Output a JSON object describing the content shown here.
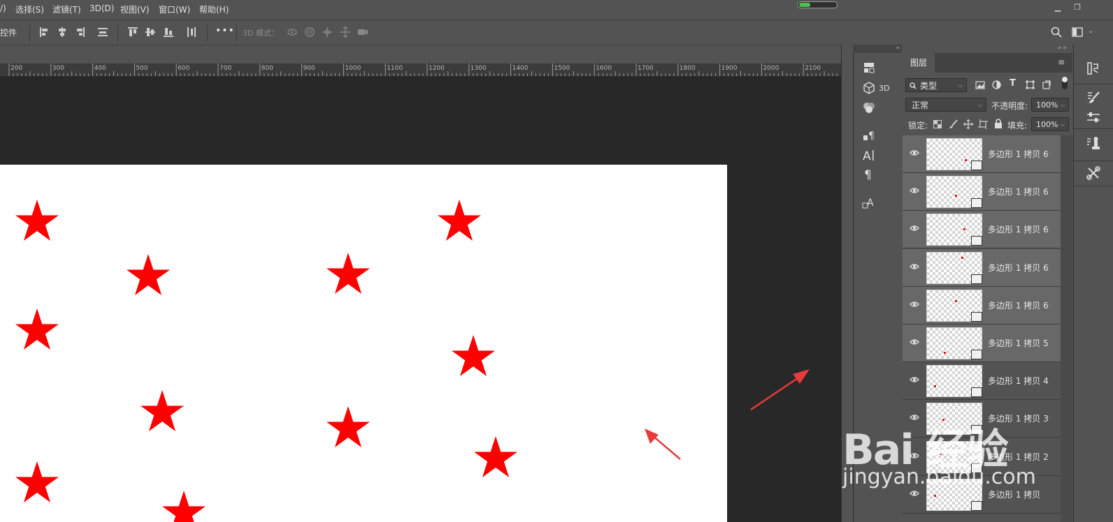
{
  "menu": {
    "items": [
      "/)",
      "选择(S)",
      "滤镜(T)",
      "3D(D)",
      "视图(V)",
      "窗口(W)",
      "帮助(H)"
    ]
  },
  "optionsbar": {
    "left_label": "控件",
    "mode_label": "3D 模式："
  },
  "ruler": {
    "ticks": [
      "200",
      "300",
      "400",
      "500",
      "600",
      "700",
      "800",
      "900",
      "1000",
      "1100",
      "1200",
      "1300",
      "1400",
      "1500",
      "1600",
      "1700",
      "1800",
      "1900",
      "2000",
      "2100"
    ]
  },
  "side_icons": {
    "label_3d": "3D"
  },
  "layers": {
    "tab_label": "图层",
    "filter_label": "类型",
    "blend_mode": "正常",
    "opacity_label": "不透明度:",
    "opacity_value": "100%",
    "lock_label": "锁定:",
    "fill_label": "填充:",
    "fill_value": "100%",
    "rows": [
      {
        "name": "多边形 1 拷贝 6",
        "visible": true
      },
      {
        "name": "多边形 1 拷贝 6",
        "visible": true
      },
      {
        "name": "多边形 1 拷贝 6",
        "visible": true
      },
      {
        "name": "多边形 1 拷贝 6",
        "visible": true
      },
      {
        "name": "多边形 1 拷贝 6",
        "visible": true
      },
      {
        "name": "多边形 1 拷贝 5",
        "visible": true
      },
      {
        "name": "多边形 1 拷贝 4",
        "visible": true
      },
      {
        "name": "多边形 1 拷贝 3",
        "visible": true
      },
      {
        "name": "多边形 1 拷贝 2",
        "visible": true
      },
      {
        "name": "多边形 1 拷贝",
        "visible": true
      }
    ]
  },
  "watermark": {
    "brand": "Bai 经验",
    "url": "jingyan.baidu.com"
  },
  "colors": {
    "star": "#ff0000",
    "arrow": "#e83a3a",
    "progress": "#4cc04c"
  }
}
